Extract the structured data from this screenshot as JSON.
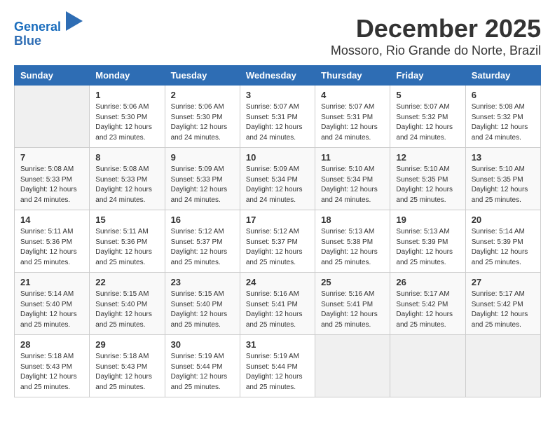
{
  "logo": {
    "line1": "General",
    "line2": "Blue"
  },
  "title": "December 2025",
  "location": "Mossoro, Rio Grande do Norte, Brazil",
  "weekdays": [
    "Sunday",
    "Monday",
    "Tuesday",
    "Wednesday",
    "Thursday",
    "Friday",
    "Saturday"
  ],
  "weeks": [
    [
      {
        "day": "",
        "info": ""
      },
      {
        "day": "1",
        "info": "Sunrise: 5:06 AM\nSunset: 5:30 PM\nDaylight: 12 hours\nand 23 minutes."
      },
      {
        "day": "2",
        "info": "Sunrise: 5:06 AM\nSunset: 5:30 PM\nDaylight: 12 hours\nand 24 minutes."
      },
      {
        "day": "3",
        "info": "Sunrise: 5:07 AM\nSunset: 5:31 PM\nDaylight: 12 hours\nand 24 minutes."
      },
      {
        "day": "4",
        "info": "Sunrise: 5:07 AM\nSunset: 5:31 PM\nDaylight: 12 hours\nand 24 minutes."
      },
      {
        "day": "5",
        "info": "Sunrise: 5:07 AM\nSunset: 5:32 PM\nDaylight: 12 hours\nand 24 minutes."
      },
      {
        "day": "6",
        "info": "Sunrise: 5:08 AM\nSunset: 5:32 PM\nDaylight: 12 hours\nand 24 minutes."
      }
    ],
    [
      {
        "day": "7",
        "info": "Sunrise: 5:08 AM\nSunset: 5:33 PM\nDaylight: 12 hours\nand 24 minutes."
      },
      {
        "day": "8",
        "info": "Sunrise: 5:08 AM\nSunset: 5:33 PM\nDaylight: 12 hours\nand 24 minutes."
      },
      {
        "day": "9",
        "info": "Sunrise: 5:09 AM\nSunset: 5:33 PM\nDaylight: 12 hours\nand 24 minutes."
      },
      {
        "day": "10",
        "info": "Sunrise: 5:09 AM\nSunset: 5:34 PM\nDaylight: 12 hours\nand 24 minutes."
      },
      {
        "day": "11",
        "info": "Sunrise: 5:10 AM\nSunset: 5:34 PM\nDaylight: 12 hours\nand 24 minutes."
      },
      {
        "day": "12",
        "info": "Sunrise: 5:10 AM\nSunset: 5:35 PM\nDaylight: 12 hours\nand 25 minutes."
      },
      {
        "day": "13",
        "info": "Sunrise: 5:10 AM\nSunset: 5:35 PM\nDaylight: 12 hours\nand 25 minutes."
      }
    ],
    [
      {
        "day": "14",
        "info": "Sunrise: 5:11 AM\nSunset: 5:36 PM\nDaylight: 12 hours\nand 25 minutes."
      },
      {
        "day": "15",
        "info": "Sunrise: 5:11 AM\nSunset: 5:36 PM\nDaylight: 12 hours\nand 25 minutes."
      },
      {
        "day": "16",
        "info": "Sunrise: 5:12 AM\nSunset: 5:37 PM\nDaylight: 12 hours\nand 25 minutes."
      },
      {
        "day": "17",
        "info": "Sunrise: 5:12 AM\nSunset: 5:37 PM\nDaylight: 12 hours\nand 25 minutes."
      },
      {
        "day": "18",
        "info": "Sunrise: 5:13 AM\nSunset: 5:38 PM\nDaylight: 12 hours\nand 25 minutes."
      },
      {
        "day": "19",
        "info": "Sunrise: 5:13 AM\nSunset: 5:39 PM\nDaylight: 12 hours\nand 25 minutes."
      },
      {
        "day": "20",
        "info": "Sunrise: 5:14 AM\nSunset: 5:39 PM\nDaylight: 12 hours\nand 25 minutes."
      }
    ],
    [
      {
        "day": "21",
        "info": "Sunrise: 5:14 AM\nSunset: 5:40 PM\nDaylight: 12 hours\nand 25 minutes."
      },
      {
        "day": "22",
        "info": "Sunrise: 5:15 AM\nSunset: 5:40 PM\nDaylight: 12 hours\nand 25 minutes."
      },
      {
        "day": "23",
        "info": "Sunrise: 5:15 AM\nSunset: 5:40 PM\nDaylight: 12 hours\nand 25 minutes."
      },
      {
        "day": "24",
        "info": "Sunrise: 5:16 AM\nSunset: 5:41 PM\nDaylight: 12 hours\nand 25 minutes."
      },
      {
        "day": "25",
        "info": "Sunrise: 5:16 AM\nSunset: 5:41 PM\nDaylight: 12 hours\nand 25 minutes."
      },
      {
        "day": "26",
        "info": "Sunrise: 5:17 AM\nSunset: 5:42 PM\nDaylight: 12 hours\nand 25 minutes."
      },
      {
        "day": "27",
        "info": "Sunrise: 5:17 AM\nSunset: 5:42 PM\nDaylight: 12 hours\nand 25 minutes."
      }
    ],
    [
      {
        "day": "28",
        "info": "Sunrise: 5:18 AM\nSunset: 5:43 PM\nDaylight: 12 hours\nand 25 minutes."
      },
      {
        "day": "29",
        "info": "Sunrise: 5:18 AM\nSunset: 5:43 PM\nDaylight: 12 hours\nand 25 minutes."
      },
      {
        "day": "30",
        "info": "Sunrise: 5:19 AM\nSunset: 5:44 PM\nDaylight: 12 hours\nand 25 minutes."
      },
      {
        "day": "31",
        "info": "Sunrise: 5:19 AM\nSunset: 5:44 PM\nDaylight: 12 hours\nand 25 minutes."
      },
      {
        "day": "",
        "info": ""
      },
      {
        "day": "",
        "info": ""
      },
      {
        "day": "",
        "info": ""
      }
    ]
  ]
}
